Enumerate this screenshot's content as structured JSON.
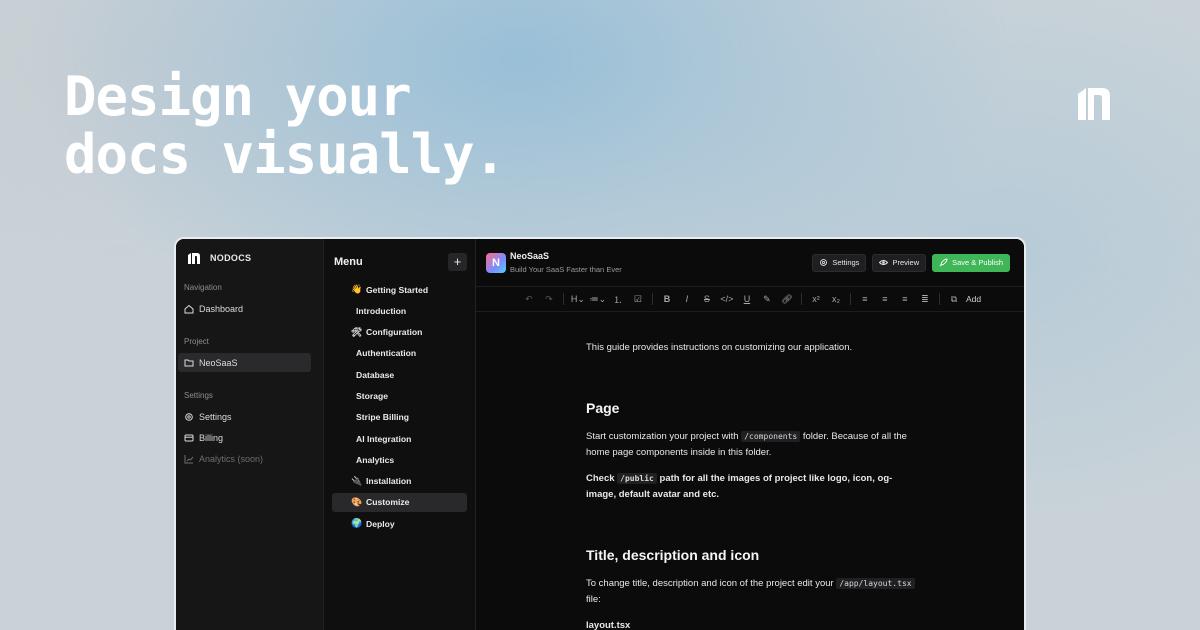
{
  "hero": {
    "line1": "Design your",
    "line2": "docs visually."
  },
  "colors": {
    "accent": "#3fb657",
    "window_bg": "#0b0b0c",
    "sidebar_bg": "#161617"
  },
  "app": {
    "logo_text": "NODOCS"
  },
  "sidebar": {
    "navigation_label": "Navigation",
    "dashboard": "Dashboard",
    "project_label": "Project",
    "project_item": "NeoSaaS",
    "settings_label": "Settings",
    "settings_item": "Settings",
    "billing_item": "Billing",
    "analytics_item": "Analytics (soon)"
  },
  "menu": {
    "title": "Menu",
    "add_symbol": "+",
    "items": [
      {
        "label": "Getting Started",
        "emoji": "👋"
      },
      {
        "label": "Introduction",
        "emoji": ""
      },
      {
        "label": "Configuration",
        "emoji": "🛠"
      },
      {
        "label": "Authentication",
        "emoji": ""
      },
      {
        "label": "Database",
        "emoji": ""
      },
      {
        "label": "Storage",
        "emoji": ""
      },
      {
        "label": "Stripe Billing",
        "emoji": ""
      },
      {
        "label": "AI Integration",
        "emoji": ""
      },
      {
        "label": "Analytics",
        "emoji": ""
      },
      {
        "label": "Installation",
        "emoji": "🔌"
      },
      {
        "label": "Customize",
        "emoji": "🎨"
      },
      {
        "label": "Deploy",
        "emoji": "🌍"
      }
    ]
  },
  "project": {
    "logo_letter": "N",
    "name": "NeoSaaS",
    "subtitle": "Build Your SaaS Faster than Ever"
  },
  "topbar": {
    "settings": "Settings",
    "preview": "Preview",
    "save": "Save & Publish"
  },
  "toolbar": {
    "add": "Add"
  },
  "doc": {
    "intro": "This guide provides instructions on customizing our application.",
    "h_page": "Page",
    "p1_a": "Start customization your project with ",
    "p1_code": "/components",
    "p1_b": " folder. Because of all the home page components inside in this folder.",
    "p2_a": "Check ",
    "p2_code": "/public",
    "p2_b": " path for all the images of project like logo, icon, og-image, default avatar and etc.",
    "h_title": "Title, description and icon",
    "p3_a": "To change title, description and icon of the project edit your ",
    "p3_code": "/app/layout.tsx",
    "p3_b": " file:",
    "p4": "layout.tsx"
  }
}
